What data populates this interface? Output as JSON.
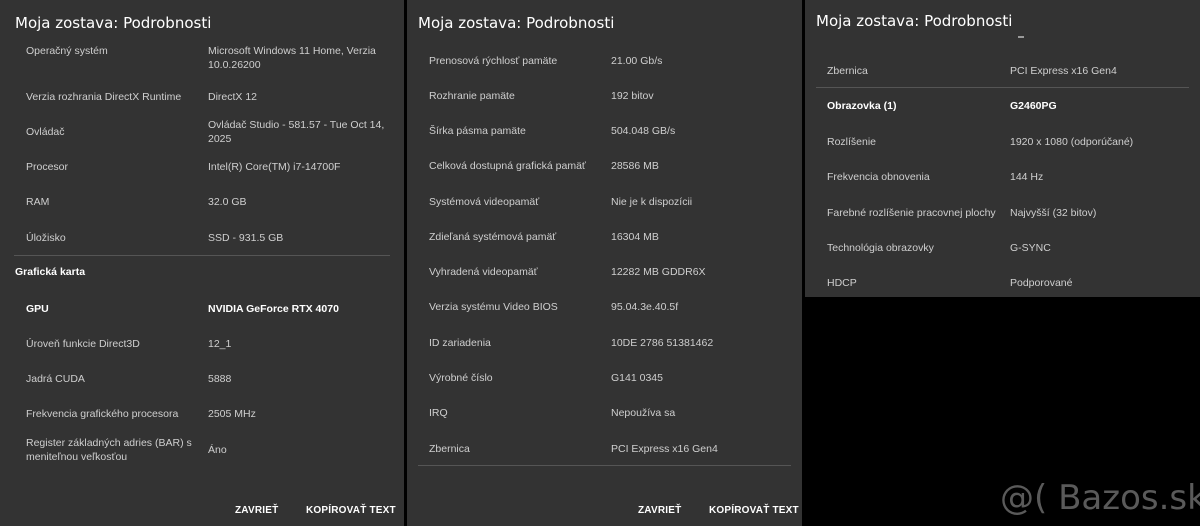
{
  "panel1": {
    "title": "Moja zostava: Podrobnosti",
    "rows": [
      {
        "label": "Operačný systém",
        "value": "Microsoft Windows 11 Home, Verzia 10.0.26200"
      },
      {
        "label": "Verzia rozhrania DirectX Runtime",
        "value": "DirectX 12"
      },
      {
        "label": "Ovládač",
        "value": "Ovládač Studio - 581.57 - Tue Oct 14, 2025"
      },
      {
        "label": "Procesor",
        "value": "Intel(R) Core(TM) i7-14700F"
      },
      {
        "label": "RAM",
        "value": "32.0 GB"
      },
      {
        "label": "Úložisko",
        "value": "SSD - 931.5 GB"
      }
    ],
    "section": "Grafická karta",
    "gpu_rows": [
      {
        "label": "GPU",
        "value": "NVIDIA GeForce RTX 4070"
      },
      {
        "label": "Úroveň funkcie Direct3D",
        "value": "12_1"
      },
      {
        "label": "Jadrá CUDA",
        "value": "5888"
      },
      {
        "label": "Frekvencia grafického procesora",
        "value": "2505 MHz"
      },
      {
        "label": "Register základných adries (BAR) s meniteľnou veľkosťou",
        "value": "Áno"
      }
    ],
    "close_label": "ZAVRIEŤ",
    "copy_label": "KOPÍROVAŤ TEXT"
  },
  "panel2": {
    "title": "Moja zostava: Podrobnosti",
    "rows": [
      {
        "label": "Prenosová rýchlosť pamäte",
        "value": "21.00 Gb/s"
      },
      {
        "label": "Rozhranie pamäte",
        "value": "192 bitov"
      },
      {
        "label": "Šírka pásma pamäte",
        "value": "504.048 GB/s"
      },
      {
        "label": "Celková dostupná grafická pamäť",
        "value": "28586 MB"
      },
      {
        "label": "Systémová videopamäť",
        "value": "Nie je k dispozícii"
      },
      {
        "label": "Zdieľaná systémová pamäť",
        "value": "16304 MB"
      },
      {
        "label": "Vyhradená videopamäť",
        "value": "12282 MB GDDR6X"
      },
      {
        "label": "Verzia systému Video BIOS",
        "value": "95.04.3e.40.5f"
      },
      {
        "label": "ID zariadenia",
        "value": "10DE 2786 51381462"
      },
      {
        "label": "Výrobné číslo",
        "value": "G141 0345"
      },
      {
        "label": "IRQ",
        "value": "Nepoužíva sa"
      },
      {
        "label": "Zbernica",
        "value": "PCI Express x16 Gen4"
      }
    ],
    "close_label": "ZAVRIEŤ",
    "copy_label": "KOPÍROVAŤ TEXT"
  },
  "panel3": {
    "title": "Moja zostava: Podrobnosti",
    "rows": [
      {
        "label": "Zbernica",
        "value": "PCI Express x16 Gen4"
      },
      {
        "label": "Obrazovka (1)",
        "value": "G2460PG"
      },
      {
        "label": "Rozlíšenie",
        "value": "1920 x 1080 (odporúčané)"
      },
      {
        "label": "Frekvencia obnovenia",
        "value": "144 Hz"
      },
      {
        "label": "Farebné rozlíšenie pracovnej plochy",
        "value": "Najvyšší (32 bitov)"
      },
      {
        "label": "Technológia obrazovky",
        "value": "G-SYNC"
      },
      {
        "label": "HDCP",
        "value": "Podporované"
      }
    ]
  },
  "watermark": "@( Bazos.sk"
}
